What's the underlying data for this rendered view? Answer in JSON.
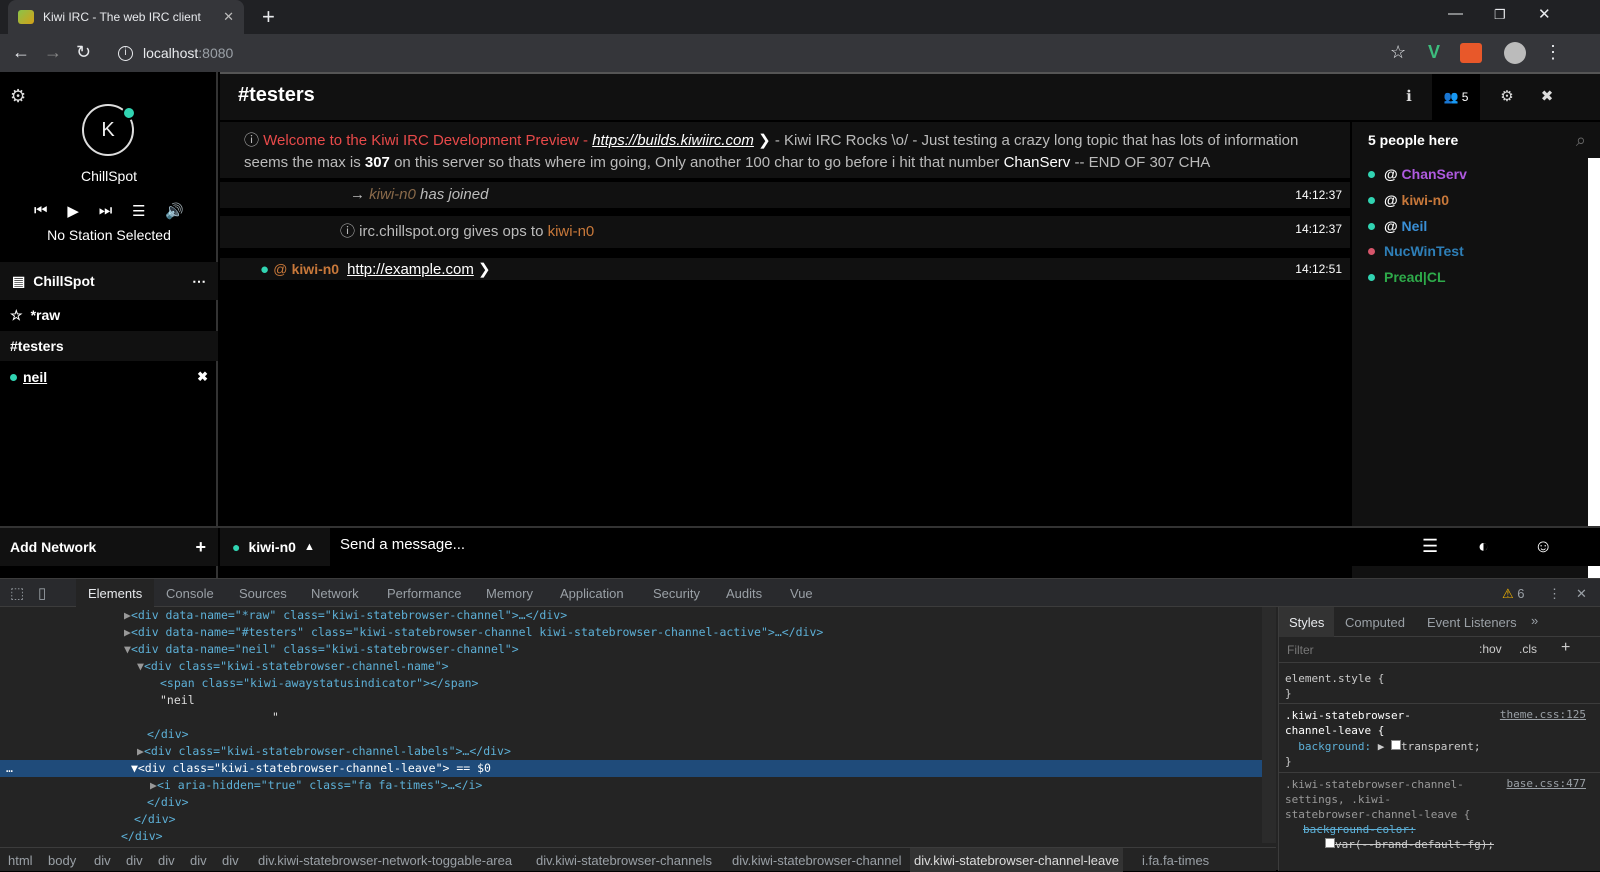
{
  "browser": {
    "tab_title": "Kiwi IRC - The web IRC client",
    "url": "localhost:8080",
    "url_host": "localhost",
    "url_port": ":8080"
  },
  "sidebar": {
    "avatar_letter": "K",
    "nick": "ChillSpot",
    "station": "No Station Selected",
    "network_name": "ChillSpot",
    "channels": [
      "*raw",
      "#testers",
      "neil"
    ],
    "add_network": "Add Network"
  },
  "channel": {
    "title": "#testers",
    "user_count": "5",
    "topic_pre": "Welcome to the Kiwi IRC Development Preview - ",
    "topic_link": "https://builds.kiwiirc.com",
    "topic_mid": " - Kiwi IRC Rocks \\o/ - Just testing a crazy long topic that has lots of information seems the max is ",
    "topic_bold": "307",
    "topic_mid2": " on this server so thats where im going, Only another 100 char to go before i hit that number ",
    "topic_white": "ChanServ",
    "topic_end": " -- END OF 307 CHA"
  },
  "messages": [
    {
      "nick": "kiwi-n0",
      "text": " has joined",
      "time": "14:12:37"
    },
    {
      "pre": "irc.chillspot.org gives ops to ",
      "nick": "kiwi-n0",
      "time": "14:12:37"
    },
    {
      "prefix": "@",
      "nick": "kiwi-n0",
      "link": "http://example.com",
      "time": "14:12:51"
    }
  ],
  "members": {
    "header": "5 people here",
    "list": [
      {
        "prefix": "@ ",
        "name": "ChanServ",
        "color": "#b05ae0",
        "dot": "#31d4b2"
      },
      {
        "prefix": "@ ",
        "name": "kiwi-n0",
        "color": "#c8783a",
        "dot": "#31d4b2"
      },
      {
        "prefix": "@ ",
        "name": "Neil",
        "color": "#3a8fd6",
        "dot": "#31d4b2"
      },
      {
        "prefix": "",
        "name": "NucWinTest",
        "color": "#2e7fb8",
        "dot": "#d6556a"
      },
      {
        "prefix": "",
        "name": "Pread|CL",
        "color": "#2eaa4a",
        "dot": "#31d4b2"
      }
    ]
  },
  "input": {
    "nick": "kiwi-n0",
    "placeholder": "Send a message..."
  },
  "devtools": {
    "tabs": [
      "Elements",
      "Console",
      "Sources",
      "Network",
      "Performance",
      "Memory",
      "Application",
      "Security",
      "Audits",
      "Vue"
    ],
    "warnings": "6",
    "style_tabs": [
      "Styles",
      "Computed",
      "Event Listeners"
    ],
    "filter_placeholder": "Filter",
    "hov": ":hov",
    "cls": ".cls",
    "breadcrumbs": [
      "html",
      "body",
      "div",
      "div",
      "div",
      "div",
      "div",
      "div.kiwi-statebrowser-network-toggable-area",
      "div.kiwi-statebrowser-channels",
      "div.kiwi-statebrowser-channel",
      "div.kiwi-statebrowser-channel-leave",
      "i.fa.fa-times"
    ],
    "dom": {
      "l1": "<div data-name=\"*raw\" class=\"kiwi-statebrowser-channel\">…</div>",
      "l2": "<div data-name=\"#testers\" class=\"kiwi-statebrowser-channel kiwi-statebrowser-channel-active\">…</div>",
      "l3": "<div data-name=\"neil\" class=\"kiwi-statebrowser-channel\">",
      "l4": "<div class=\"kiwi-statebrowser-channel-name\">",
      "l5": "<span class=\"kiwi-awaystatusindicator\"></span>",
      "l6": "\"neil",
      "l7": "\"",
      "l8": "</div>",
      "l9": "<div class=\"kiwi-statebrowser-channel-labels\">…</div>",
      "l10": "<div class=\"kiwi-statebrowser-channel-leave\"> == $0",
      "l11": "<i aria-hidden=\"true\" class=\"fa fa-times\">…</i>",
      "l12": "</div>",
      "l13": "</div>",
      "l14": "</div>"
    },
    "styles": {
      "s1": "element.style {\n}",
      "s2": ".kiwi-statebrowser-\nchannel-leave {",
      "s2src": "theme.css:125",
      "s2prop": "  background:",
      "s2val": "transparent;",
      "s2end": "}",
      "s3": ".kiwi-statebrowser-channel-\nsettings, .kiwi-\nstatebrowser-channel-leave {",
      "s3src": "base.css:477",
      "s3prop": "background-color:",
      "s3val": "var(--brand-default-fg);"
    }
  }
}
